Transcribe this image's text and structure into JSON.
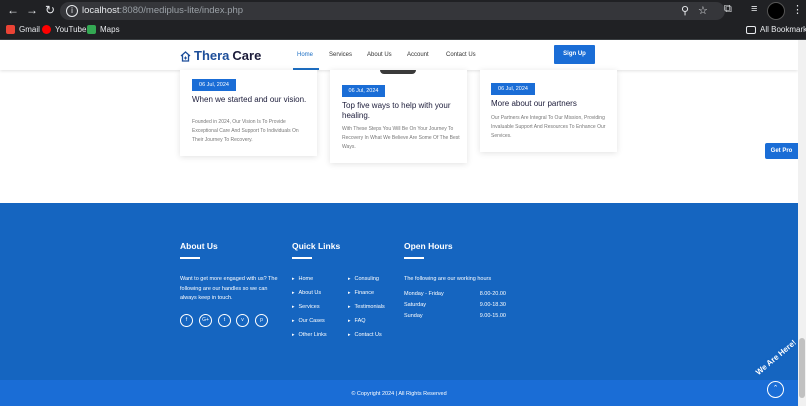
{
  "browser": {
    "url_host": "localhost",
    "url_rest": ":8080/mediplus-lite/index.php",
    "bookmarks": [
      {
        "label": "Gmail",
        "color": "#ea4335"
      },
      {
        "label": "YouTube",
        "color": "#ff0000"
      },
      {
        "label": "Maps",
        "color": "#34a853"
      }
    ],
    "all_bookmarks": "All Bookmarks"
  },
  "site": {
    "logo_primary": "Thera",
    "logo_secondary": "Care",
    "nav": [
      "Home",
      "Services",
      "About Us",
      "Account",
      "Contact Us"
    ],
    "signup": "Sign Up",
    "get_pro": "Get Pro"
  },
  "cards": [
    {
      "date": "06 Jul, 2024",
      "title": "When we started and our vision.",
      "text": "Founded in 2024, Our Vision Is To Provide Exceptional Care And Support To Individuals On Their Journey To Recovery."
    },
    {
      "date": "06 Jul, 2024",
      "title": "Top five ways to help with your healing.",
      "text": "With These Steps You Will Be On Your Journey To Recovery In What We Believe Are Some Of The Best Ways."
    },
    {
      "date": "06 Jul, 2024",
      "title": "More about our partners",
      "text": "Our Partners Are Integral To Our Mission, Providing Invaluable Support And Resources To Enhance Our Services."
    }
  ],
  "footer": {
    "about_title": "About Us",
    "about_text": "Want to get more engaged with us? The following are our handles so we can always keep in touch.",
    "social": [
      "f",
      "G+",
      "t",
      "v",
      "p"
    ],
    "links_title": "Quick Links",
    "links_col1": [
      "Home",
      "About Us",
      "Services",
      "Our Cases",
      "Other Links"
    ],
    "links_col2": [
      "Consuling",
      "Finance",
      "Testimonials",
      "FAQ",
      "Contact Us"
    ],
    "hours_title": "Open Hours",
    "hours_intro": "The following are our working hours",
    "hours": [
      {
        "day": "Monday - Friday",
        "time": "8.00-20.00"
      },
      {
        "day": "Saturday",
        "time": "9.00-18.30"
      },
      {
        "day": "Sunday",
        "time": "9.00-15.00"
      }
    ],
    "copyright": "© Copyright 2024 | All Rights Reserved"
  },
  "chat": {
    "label": "We Are Here!"
  }
}
